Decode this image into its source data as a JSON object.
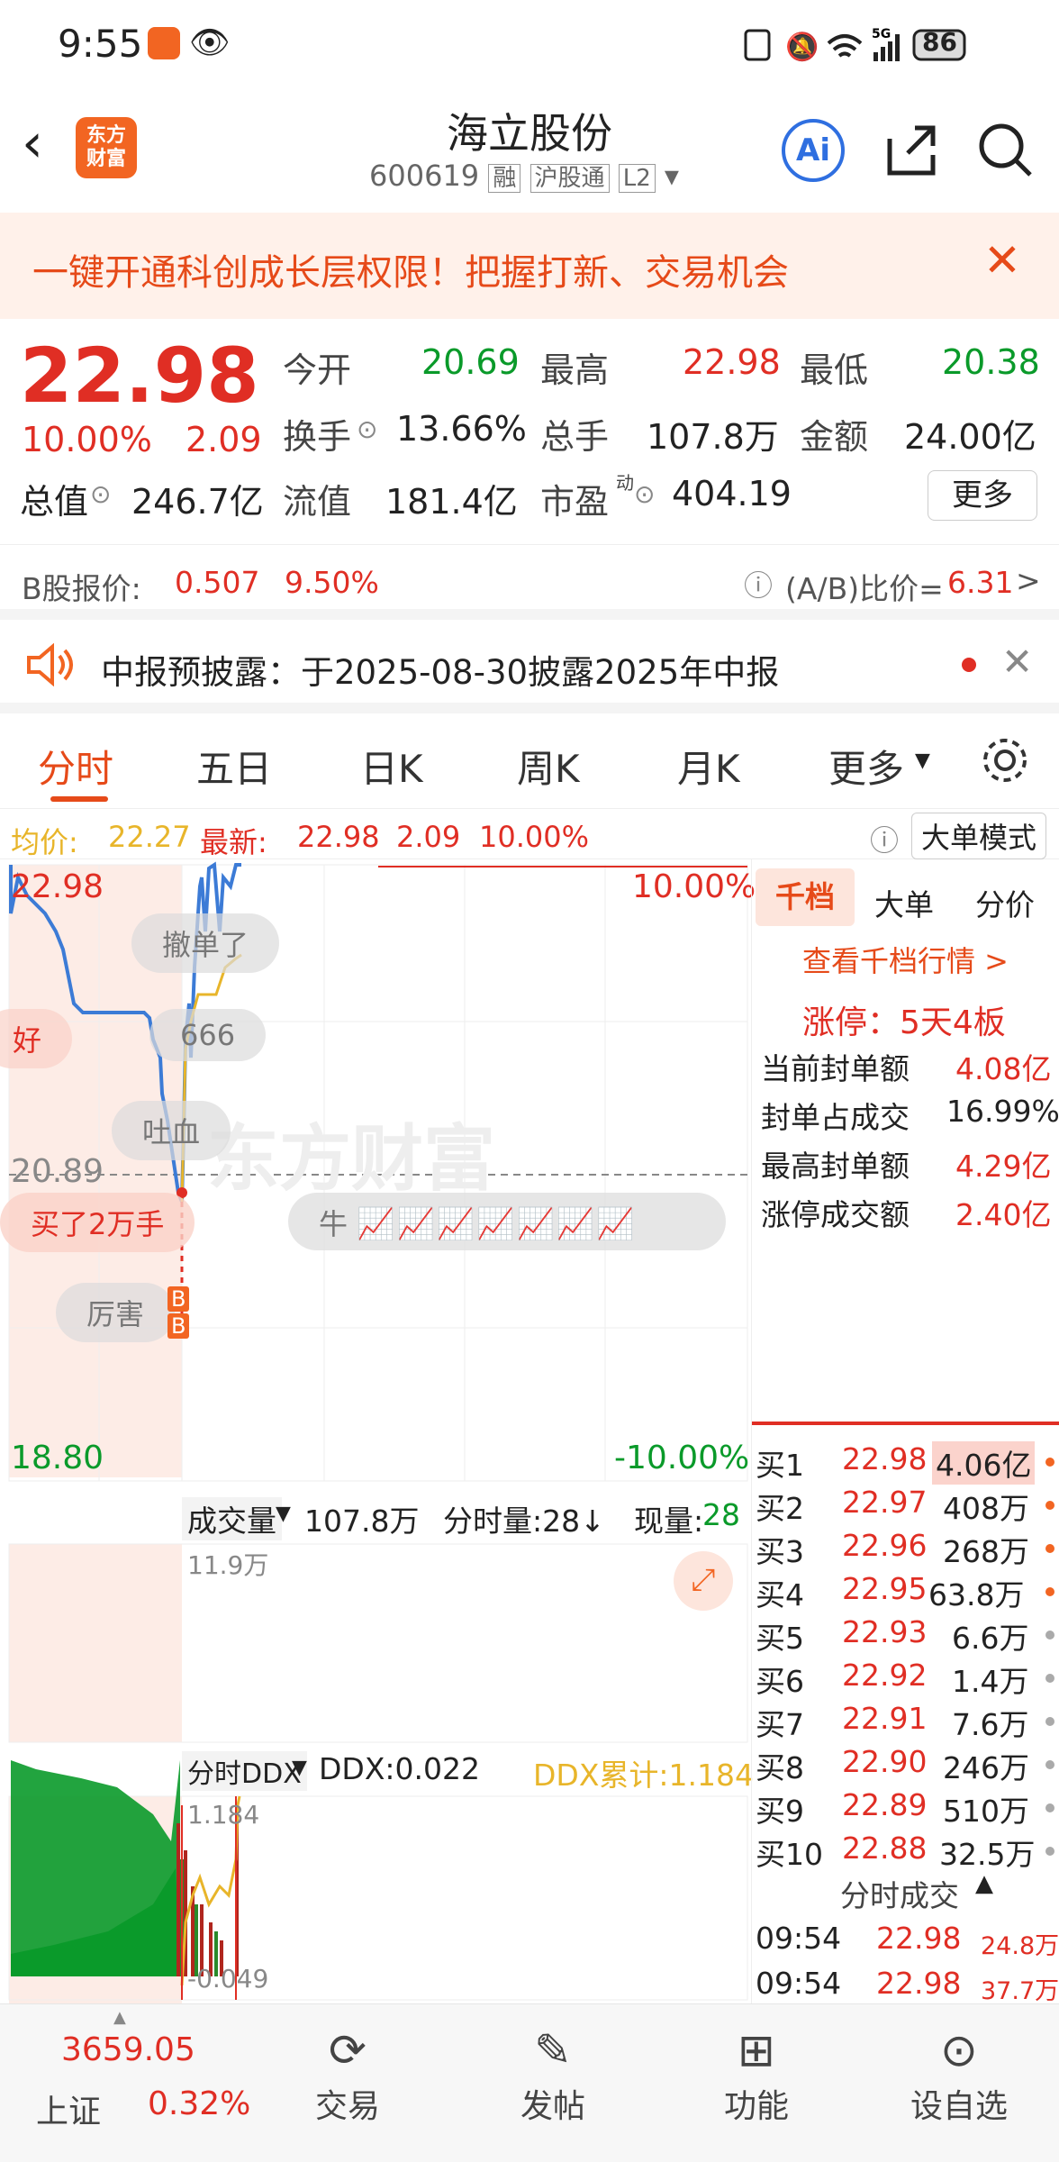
{
  "status": {
    "time": "9:55",
    "battery": "86",
    "net": "5G"
  },
  "header": {
    "title": "海立股份",
    "code": "600619",
    "tag_rong": "融",
    "tag_hgt": "沪股通",
    "tag_l2": "L2",
    "logo": "东方\n财富",
    "ai": "Ai"
  },
  "banner": {
    "text": "一键开通科创成长层权限！把握打新、交易机会"
  },
  "quote": {
    "price": "22.98",
    "pct": "10.00%",
    "chg": "2.09",
    "open_label": "今开",
    "open": "20.69",
    "high_label": "最高",
    "high": "22.98",
    "low_label": "最低",
    "low": "20.38",
    "turnover_label": "换手",
    "turnover": "13.66%",
    "vol_label": "总手",
    "vol": "107.8万",
    "amt_label": "金额",
    "amt": "24.00亿",
    "mcap_label": "总值",
    "mcap": "246.7亿",
    "float_label": "流值",
    "float": "181.4亿",
    "pe_label": "市盈",
    "pe_sup": "动",
    "pe": "404.19",
    "more": "更多"
  },
  "bshare": {
    "label": "B股报价:",
    "price": "0.507",
    "pct": "9.50%",
    "ratio_label": "(A/B)比价=",
    "ratio": "6.31",
    "arrow": ">"
  },
  "notice": {
    "text": "中报预披露：于2025-08-30披露2025年中报"
  },
  "tabs": [
    "分时",
    "五日",
    "日K",
    "周K",
    "月K",
    "更多"
  ],
  "infobar": {
    "avg_label": "均价:",
    "avg": "22.27",
    "last_label": "最新:",
    "last": "22.98",
    "chg": "2.09",
    "pct": "10.00%",
    "mode": "大单模式"
  },
  "chart": {
    "top_price": "22.98",
    "top_pct": "10.00%",
    "mid": "20.89",
    "bot_price": "18.80",
    "bot_pct": "-10.00%",
    "bubbles": [
      "撤单了",
      "666",
      "好",
      "吐血",
      "买了2万手",
      "厉害"
    ],
    "bull": "牛",
    "watermark": "东方财富",
    "vol_label": "成交量",
    "vol_val": "107.8万",
    "vol_min": "分时量:28↓",
    "vol_now_label": "现量:",
    "vol_now": "28",
    "vol_max": "11.9万",
    "ddx_label": "分时DDX",
    "ddx": "DDX:0.022",
    "ddx_sum": "DDX累计:1.184",
    "ddx_top": "1.184",
    "ddx_bot": "-0.049",
    "b_marker": "B"
  },
  "side": {
    "tabs": [
      "千档",
      "大单",
      "分价"
    ],
    "link": "查看千档行情 >",
    "limit": "涨停：5天4板",
    "stats": [
      [
        "当前封单额",
        "4.08亿"
      ],
      [
        "封单占成交",
        "16.99%"
      ],
      [
        "最高封单额",
        "4.29亿"
      ],
      [
        "涨停成交额",
        "2.40亿"
      ]
    ],
    "book": [
      [
        "买1",
        "22.98",
        "4.06亿"
      ],
      [
        "买2",
        "22.97",
        "408万"
      ],
      [
        "买3",
        "22.96",
        "268万"
      ],
      [
        "买4",
        "22.95",
        "63.8万"
      ],
      [
        "买5",
        "22.93",
        "6.6万"
      ],
      [
        "买6",
        "22.92",
        "1.4万"
      ],
      [
        "买7",
        "22.91",
        "7.6万"
      ],
      [
        "买8",
        "22.90",
        "246万"
      ],
      [
        "买9",
        "22.89",
        "510万"
      ],
      [
        "买10",
        "22.88",
        "32.5万"
      ]
    ],
    "trades_label": "分时成交",
    "trades": [
      [
        "09:54",
        "22.98",
        "24.8万"
      ],
      [
        "09:54",
        "22.98",
        "37.7万"
      ]
    ]
  },
  "bottom": {
    "index_val": "3659.05",
    "index_name": "上证",
    "index_pct": "0.32%",
    "items": [
      "交易",
      "发帖",
      "功能",
      "设自选"
    ]
  }
}
